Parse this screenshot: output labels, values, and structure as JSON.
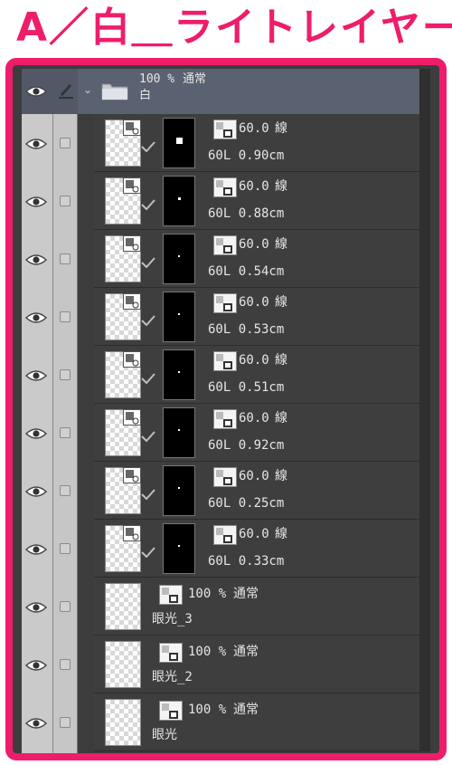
{
  "title": "A／白＿ライトレイヤー",
  "folder": {
    "opacity": "100 %",
    "blend": "通常",
    "name": "白"
  },
  "masked_layers": [
    {
      "opacity": "60.0",
      "blend": "線",
      "name": "60L 0.90cm",
      "dot_size": "large"
    },
    {
      "opacity": "60.0",
      "blend": "線",
      "name": "60L 0.88cm",
      "dot_size": "small"
    },
    {
      "opacity": "60.0",
      "blend": "線",
      "name": "60L 0.54cm",
      "dot_size": "tiny"
    },
    {
      "opacity": "60.0",
      "blend": "線",
      "name": "60L 0.53cm",
      "dot_size": "tiny"
    },
    {
      "opacity": "60.0",
      "blend": "線",
      "name": "60L 0.51cm",
      "dot_size": "tiny"
    },
    {
      "opacity": "60.0",
      "blend": "線",
      "name": "60L 0.92cm",
      "dot_size": "tiny"
    },
    {
      "opacity": "60.0",
      "blend": "線",
      "name": "60L 0.25cm",
      "dot_size": "tiny"
    },
    {
      "opacity": "60.0",
      "blend": "線",
      "name": "60L 0.33cm",
      "dot_size": "tiny"
    }
  ],
  "plain_layers": [
    {
      "opacity": "100 %",
      "blend": "通常",
      "name": "眼光_3"
    },
    {
      "opacity": "100 %",
      "blend": "通常",
      "name": "眼光_2"
    },
    {
      "opacity": "100 %",
      "blend": "通常",
      "name": "眼光"
    }
  ],
  "colors": {
    "accent": "#ee1d6b",
    "panel": "#3c3c3c",
    "folder": "#5a6170"
  },
  "icons": {
    "eye": "eye-icon",
    "pen": "pencil-icon",
    "folder": "folder-icon",
    "chevron": "chevron-down-icon",
    "check": "checkmark-icon",
    "mask": "layer-mask-icon",
    "blend": "blend-mode-icon"
  }
}
